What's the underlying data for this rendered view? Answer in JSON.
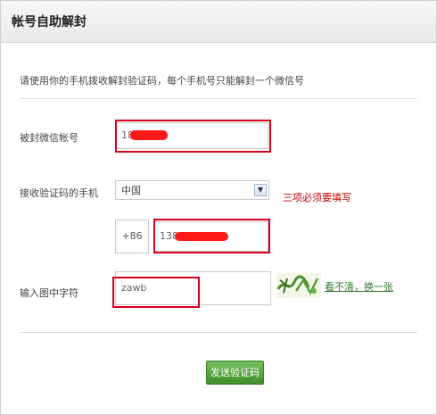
{
  "header": {
    "title": "帐号自助解封"
  },
  "description": "请使用你的手机拨收解封验证码，每个手机号只能解封一个微信号",
  "form": {
    "wechat_account": {
      "label": "被封微信帐号",
      "value": "18"
    },
    "phone": {
      "label": "接收验证码的手机",
      "country": "中国",
      "country_code": "+86",
      "number": "1388"
    },
    "required_hint": "三项必须要填写",
    "captcha": {
      "label": "输入图中字符",
      "value": "zawb",
      "refresh_link": "看不清，换一张"
    },
    "submit_label": "发送验证码"
  }
}
